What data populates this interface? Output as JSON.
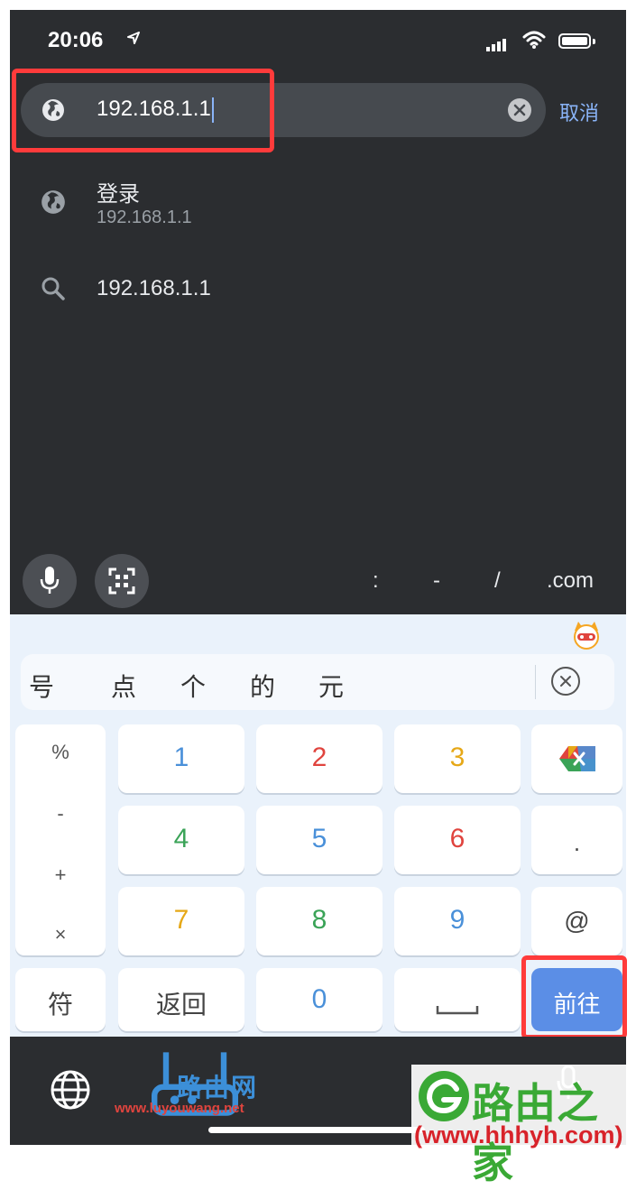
{
  "status_bar": {
    "time": "20:06"
  },
  "address_bar": {
    "value": "192.168.1.1",
    "cancel_label": "取消"
  },
  "suggestions": [
    {
      "title": "登录",
      "subtitle": "192.168.1.1",
      "icon": "globe-icon"
    },
    {
      "title": "192.168.1.1",
      "icon": "search-icon"
    }
  ],
  "toolbar": {
    "symbols": [
      ":",
      "-",
      "/",
      ".com"
    ]
  },
  "keyboard": {
    "candidates": [
      "号",
      "点",
      "个",
      "的",
      "元"
    ],
    "side_symbols": [
      "%",
      "-",
      "+",
      "×"
    ],
    "keys": {
      "k1": "1",
      "k2": "2",
      "k3": "3",
      "k4": "4",
      "k5": "5",
      "k6": "6",
      "k7": "7",
      "k8": "8",
      "k9": "9",
      "k0": "0",
      "dot": ".",
      "at": "@",
      "fu": "符",
      "back": "返回",
      "go": "前往"
    },
    "digit_colors": {
      "blue": "#4a90d9",
      "red": "#e0443e",
      "yellow": "#e6a817",
      "green": "#3aa357"
    }
  },
  "watermarks": {
    "luyouwang_name": "路由网",
    "luyouwang_url": "www.luyouwang.net",
    "hhhyh_name": "路由之家",
    "hhhyh_url": "(www.hhhyh.com)"
  },
  "colors": {
    "highlight_border": "#ff3b3b",
    "accent": "#8ab4f8",
    "go_key": "#5b8ee6"
  }
}
